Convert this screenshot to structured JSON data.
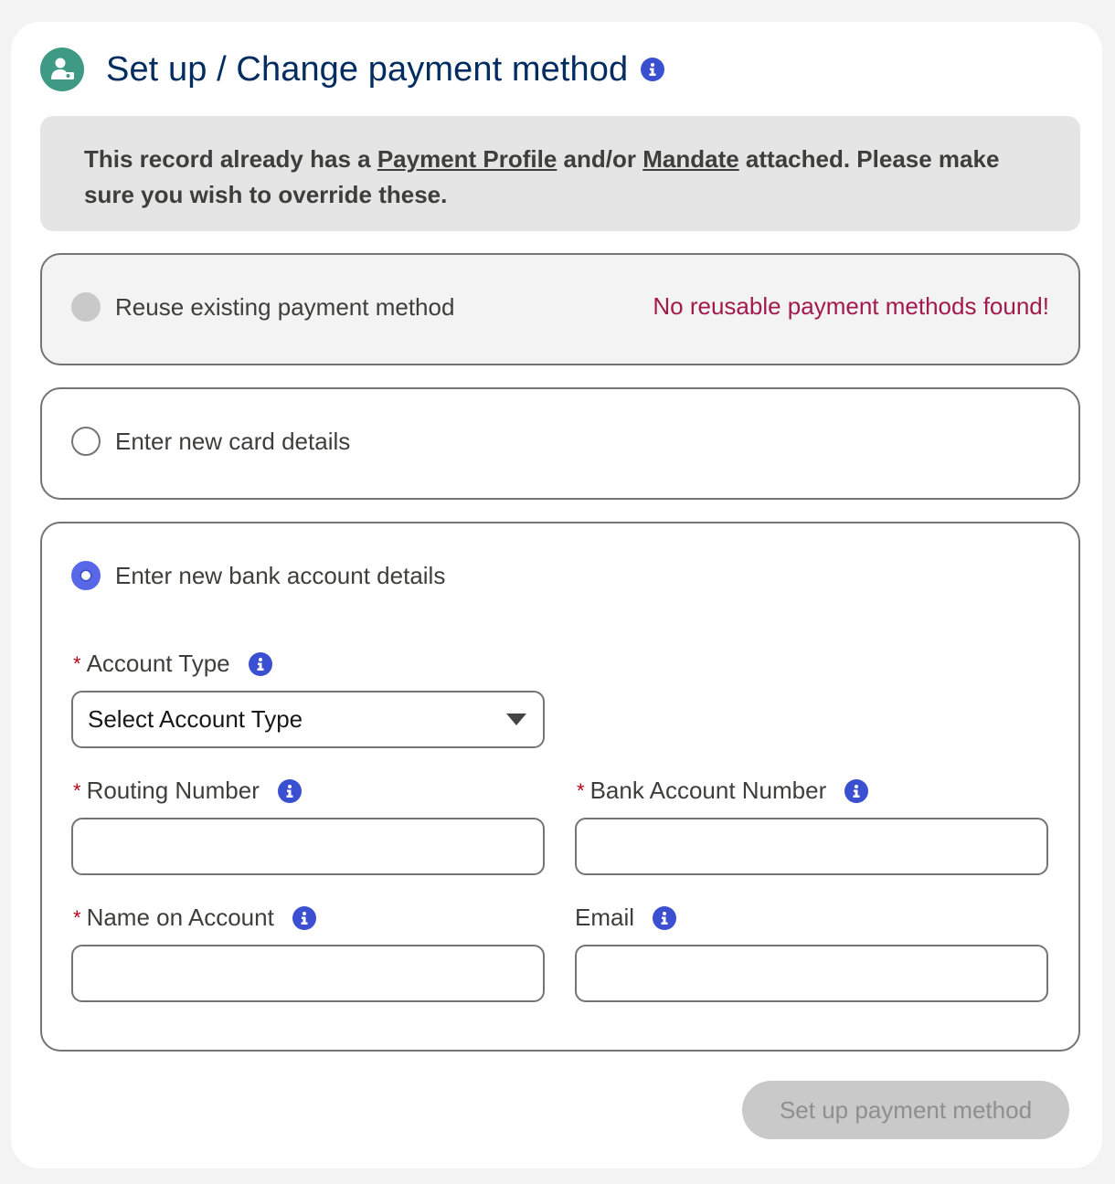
{
  "header": {
    "icon": "user-payment-icon",
    "title": "Set up / Change payment method",
    "info_icon": "info-icon"
  },
  "notice": {
    "text_1": "This record already has a ",
    "link_1": "Payment Profile",
    "text_2": " and/or ",
    "link_2": "Mandate",
    "text_3": " attached. Please make sure you wish to override these."
  },
  "options": {
    "reuse": {
      "label": "Reuse existing payment method",
      "warning": "No reusable payment methods found!",
      "state": "disabled"
    },
    "card": {
      "label": "Enter new card details",
      "state": "unchecked"
    },
    "bank": {
      "label": "Enter new bank account details",
      "state": "checked"
    }
  },
  "bank_form": {
    "required_marker": "*",
    "account_type": {
      "label": "Account Type",
      "value": "Select Account Type"
    },
    "routing_number": {
      "label": "Routing Number",
      "value": ""
    },
    "bank_account_number": {
      "label": "Bank Account Number",
      "value": ""
    },
    "name_on_account": {
      "label": "Name on Account",
      "value": ""
    },
    "email": {
      "label": "Email",
      "value": ""
    }
  },
  "submit": {
    "label": "Set up payment method",
    "state": "disabled"
  },
  "colors": {
    "accent": "#3b4fd1",
    "title": "#032d60",
    "warning": "#a21a4a",
    "header_icon_bg": "#3e9a85"
  }
}
